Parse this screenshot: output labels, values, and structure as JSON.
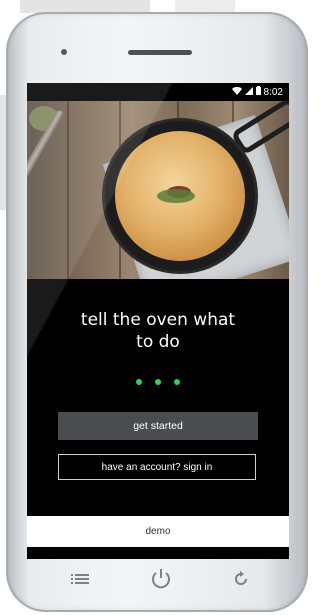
{
  "status_bar": {
    "time": "8:02",
    "icons": [
      "wifi-icon",
      "signal-icon",
      "battery-icon"
    ]
  },
  "hero": {
    "image_subject": "pot pie in cast iron skillet"
  },
  "onboarding": {
    "tagline_line1": "tell the oven what",
    "tagline_line2": "to do",
    "page_dots": 3,
    "dot_color": "#2fd05a"
  },
  "actions": {
    "get_started_label": "get started",
    "sign_in_label": "have an account? sign in",
    "demo_label": "demo"
  },
  "device_nav": {
    "icons": [
      "menu-icon",
      "power-icon",
      "refresh-icon"
    ]
  },
  "colors": {
    "screen_bg": "#000000",
    "primary_button": "#4a4d4f",
    "demo_button": "#ffffff"
  }
}
